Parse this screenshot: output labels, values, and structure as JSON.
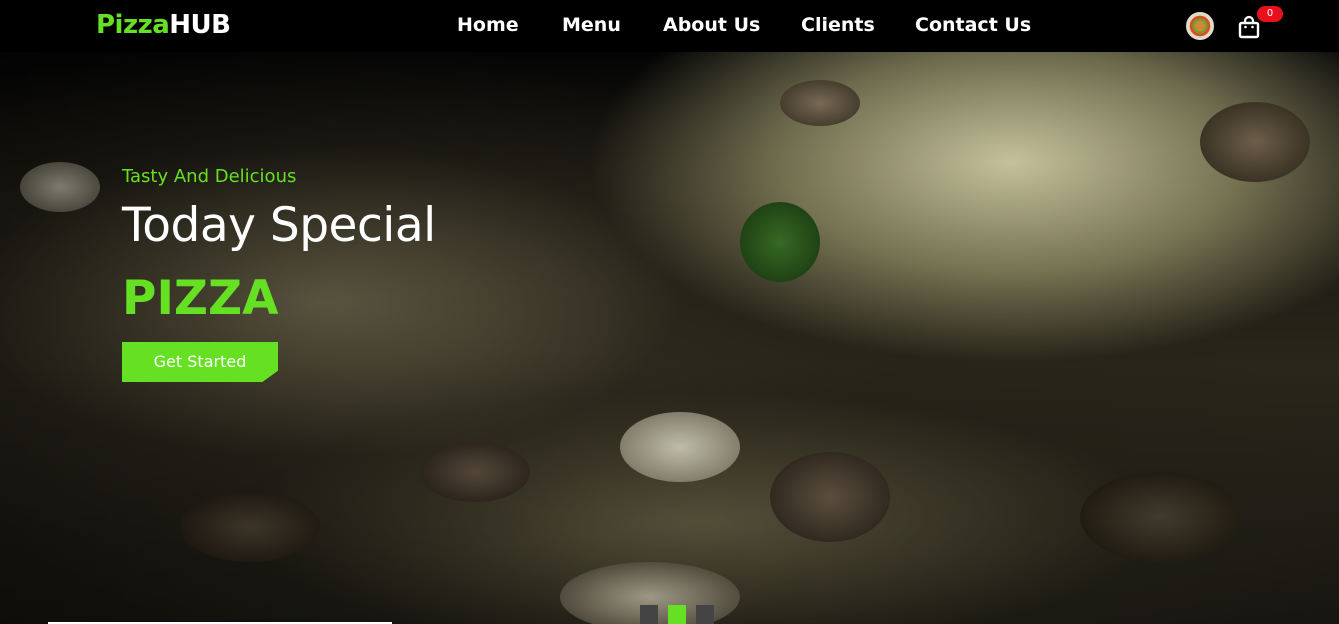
{
  "brand": {
    "name_part1": "Pizza",
    "name_part2": "HUB"
  },
  "nav": {
    "items": [
      {
        "label": "Home"
      },
      {
        "label": "Menu"
      },
      {
        "label": "About Us"
      },
      {
        "label": "Clients"
      },
      {
        "label": "Contact Us"
      }
    ]
  },
  "header": {
    "avatar_icon": "pizza-avatar-icon",
    "cart_icon": "shopping-bag-icon",
    "cart_count": "0"
  },
  "hero": {
    "tagline": "Tasty And Delicious",
    "headline": "Today Special",
    "product": "PIZZA",
    "cta_label": "Get Started",
    "slides_total": 3,
    "slide_active": 2
  },
  "colors": {
    "accent": "#65e023",
    "background": "#000000",
    "badge": "#e8101a",
    "text": "#ffffff"
  }
}
